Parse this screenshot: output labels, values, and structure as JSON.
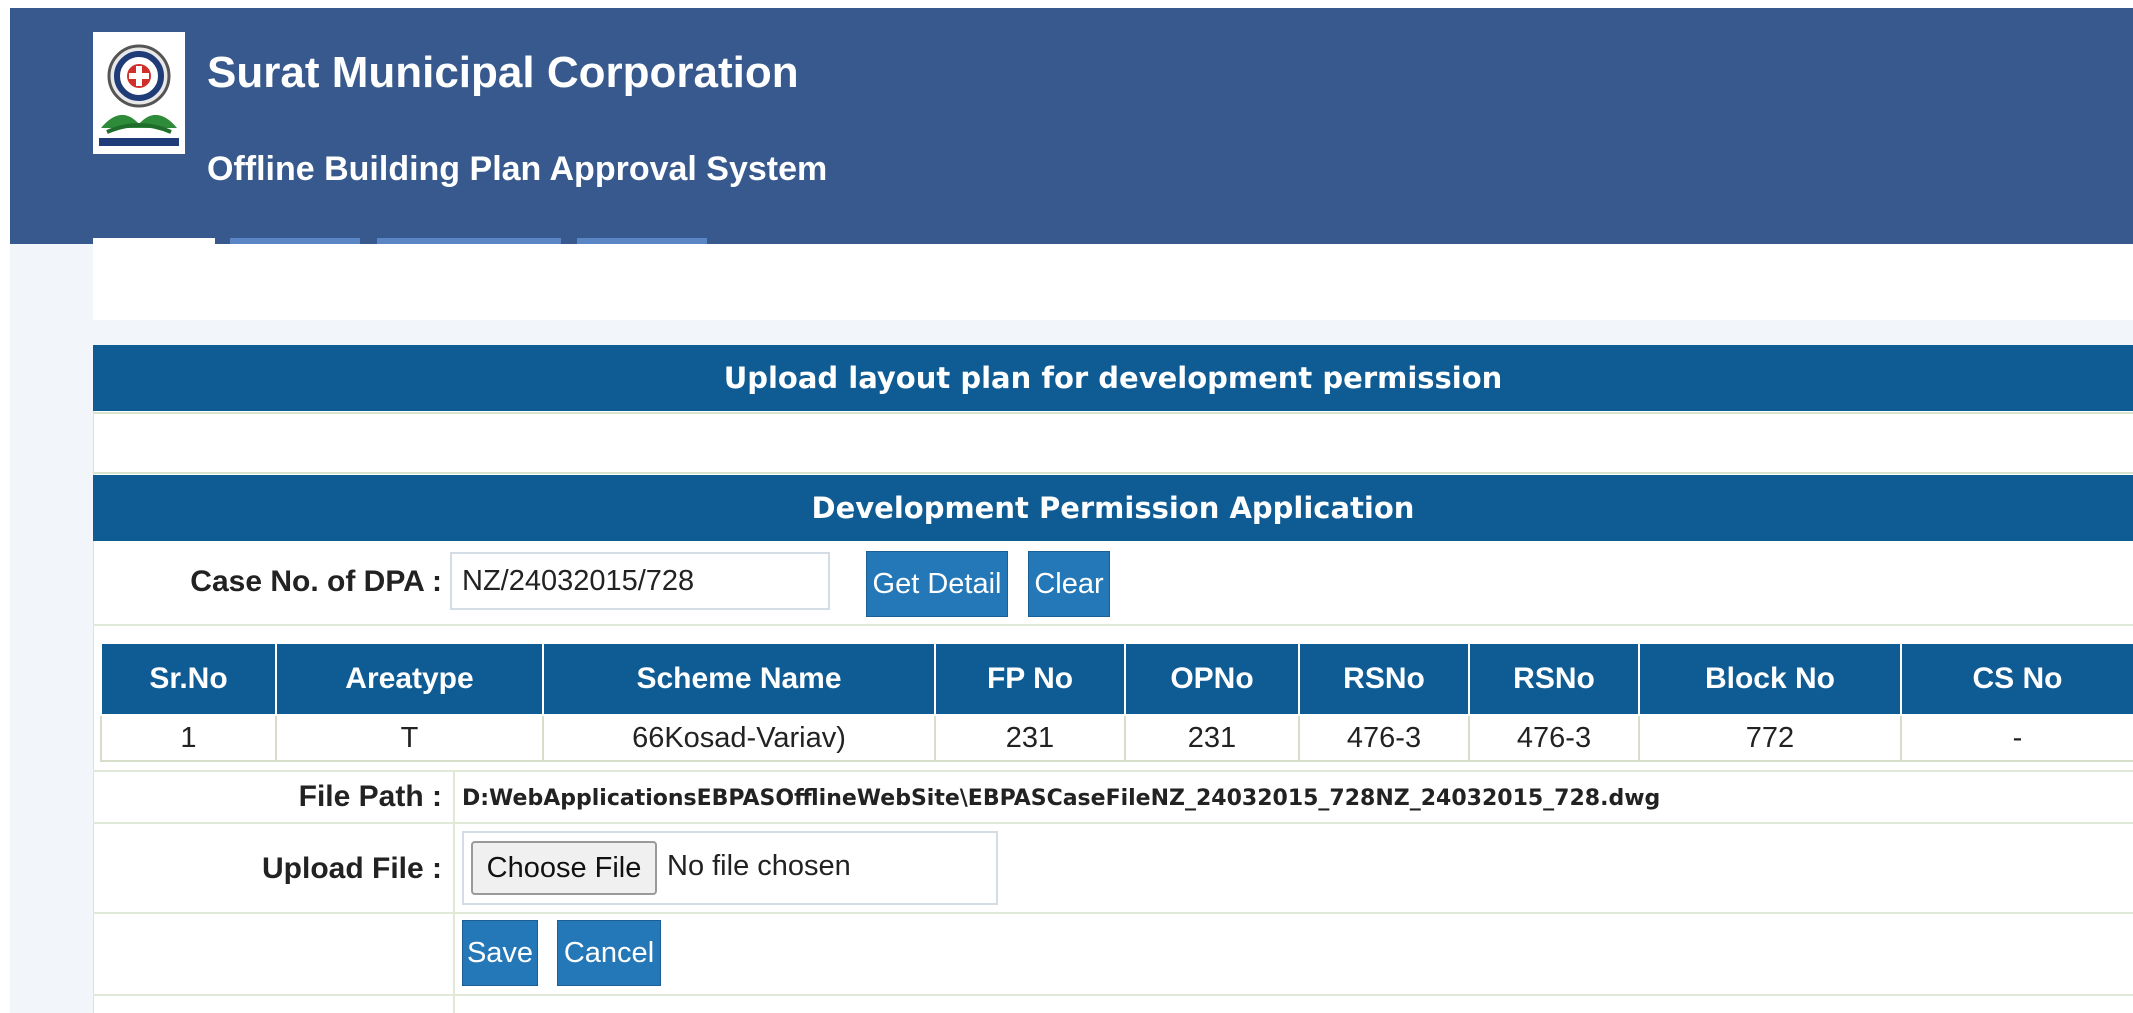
{
  "header": {
    "title": "Surat Municipal Corporation",
    "subtitle": "Offline Building Plan Approval System"
  },
  "colors": {
    "header_bg": "#37598d",
    "banner_bg": "#0f5b93",
    "button_bg": "#2578b7"
  },
  "upload_banner": "Upload layout plan for development permission",
  "application_banner": "Development Permission Application",
  "case_form": {
    "label": "Case No. of DPA :",
    "value": "NZ/24032015/728",
    "get_detail_label": "Get Detail",
    "clear_label": "Clear"
  },
  "table": {
    "columns": [
      "Sr.No",
      "Areatype",
      "Scheme Name",
      "FP No",
      "OPNo",
      "RSNo",
      "RSNo",
      "Block No",
      "CS No"
    ],
    "rows": [
      [
        "1",
        "T",
        "66Kosad-Variav)",
        "231",
        "231",
        "476-3",
        "476-3",
        "772",
        "-"
      ]
    ]
  },
  "file_path": {
    "label": "File Path :",
    "value": "D:WebApplicationsEBPASOfflineWebSite\\EBPASCaseFileNZ_24032015_728NZ_24032015_728.dwg"
  },
  "upload_file": {
    "label": "Upload File :",
    "button_label": "Choose File",
    "status": "No file chosen"
  },
  "actions": {
    "save_label": "Save",
    "cancel_label": "Cancel"
  }
}
